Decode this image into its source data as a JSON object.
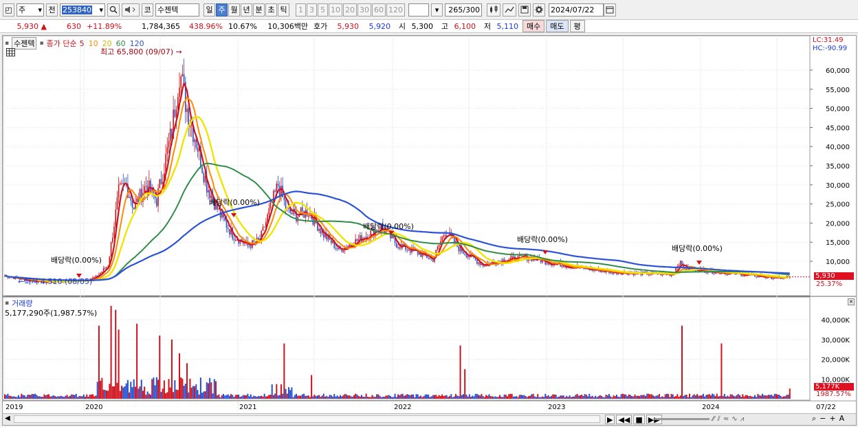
{
  "toolbar": {
    "market": "주",
    "prev_label": "전",
    "code": "253840",
    "search_icon": "search-icon",
    "sound_icon": "speaker-icon",
    "market_type": "코",
    "stock_name": "수젠텍",
    "periods": [
      {
        "label": "일",
        "active": false
      },
      {
        "label": "주",
        "active": true
      },
      {
        "label": "월",
        "active": false
      },
      {
        "label": "년",
        "active": false
      },
      {
        "label": "분",
        "active": false
      },
      {
        "label": "초",
        "active": false
      },
      {
        "label": "틱",
        "active": false
      }
    ],
    "intervals": [
      "1",
      "3",
      "5",
      "10",
      "20",
      "30",
      "60",
      "120"
    ],
    "count_value": "265",
    "count_max": "/300",
    "date": "2024/07/22"
  },
  "quote": {
    "price": "5,930",
    "arrow": "▲",
    "change": "630",
    "change_pct": "+11.89%",
    "volume": "1,784,365",
    "volume_ratio": "438.96%",
    "turnover": "10.67%",
    "trade_amount": "10,306백만",
    "hoga_label": "호가",
    "ask": "5,930",
    "bid": "5,920",
    "open_label": "시",
    "open": "5,300",
    "high_label": "고",
    "high": "6,100",
    "low_label": "저",
    "low": "5,110",
    "buy_label": "매수",
    "sell_label": "매도",
    "eval_label": "평"
  },
  "legend": {
    "stock_tag": "수젠텍",
    "ma_label": "종가 단순",
    "ma_periods": [
      {
        "label": "5",
        "color": "#d0101a"
      },
      {
        "label": "10",
        "color": "#ff8a00"
      },
      {
        "label": "20",
        "color": "#e6d800"
      },
      {
        "label": "60",
        "color": "#2f8c4a"
      },
      {
        "label": "120",
        "color": "#2b51d8"
      }
    ]
  },
  "annotations": {
    "high_marker": "최고 65,800 (09/07)",
    "low_marker": "최저 4,510 (08/05)",
    "dividends": [
      "배당락(0.00%)",
      "배당락(0.00%)",
      "배당락(0.00%)",
      "배당락(0.00%)",
      "배당락(0.00%)"
    ]
  },
  "price_axis": {
    "lc": "LC:31.49",
    "hc": "HC:-90.99",
    "ticks": [
      "60,000",
      "55,000",
      "50,000",
      "45,000",
      "40,000",
      "35,000",
      "30,000",
      "25,000",
      "20,000",
      "15,000",
      "10,000"
    ],
    "current_price": "5,930",
    "current_pct": "25.37%"
  },
  "volume_panel": {
    "title": "거래량",
    "value": "5,177,290주(1,987.57%)",
    "ticks": [
      "40,000K",
      "30,000K",
      "20,000K",
      "10,000K"
    ],
    "current": "5,177K",
    "current_pct": "1987.57%"
  },
  "time_axis": {
    "labels": [
      "2019",
      "2020",
      "2021",
      "2022",
      "2023",
      "2024"
    ],
    "end_date": "07/22"
  },
  "colors": {
    "up": "#d0101a",
    "down": "#1f4fd6",
    "ma5": "#d0101a",
    "ma10": "#ff8a00",
    "ma20": "#f0e400",
    "ma60": "#2f8c4a",
    "ma120": "#2b51d8"
  }
}
